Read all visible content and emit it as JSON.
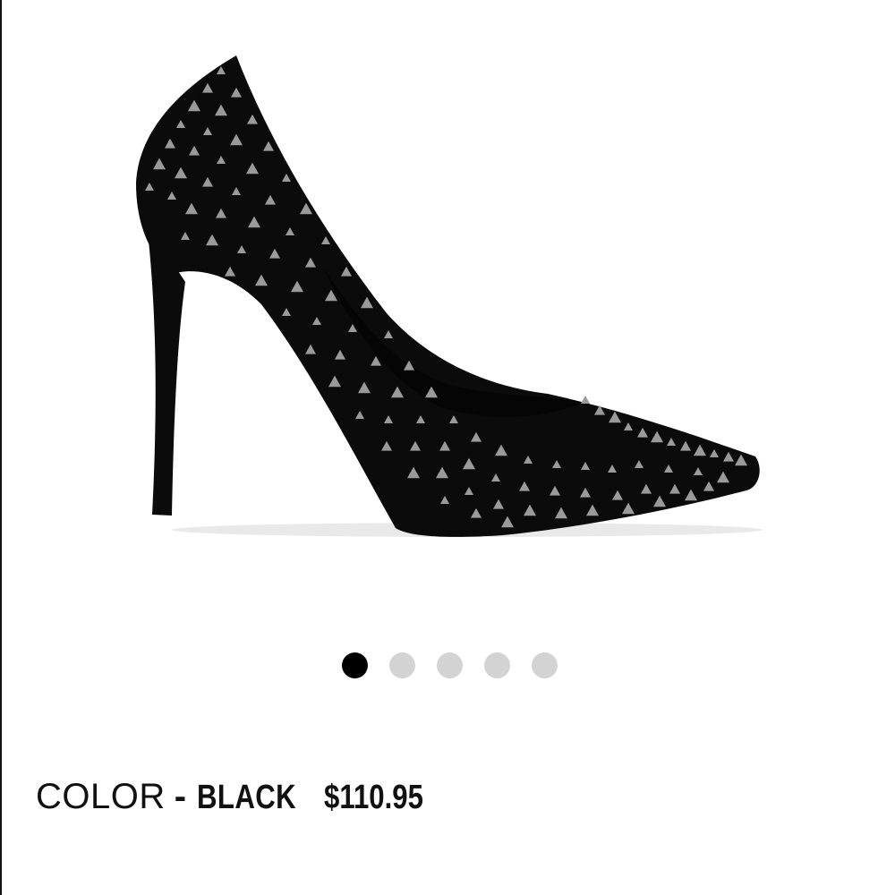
{
  "product": {
    "image_alt": "Black spiked pointed-toe stiletto pump",
    "color_label": "COLOR",
    "color_separator": "-",
    "color_value": "BLACK",
    "price": "$110.95",
    "colors": {
      "shoe": "#0b0b0b",
      "studs": "#9a9a9a",
      "dot_active": "#000000",
      "dot_inactive": "#d3d3d3"
    }
  },
  "carousel": {
    "total": 5,
    "active_index": 0
  }
}
